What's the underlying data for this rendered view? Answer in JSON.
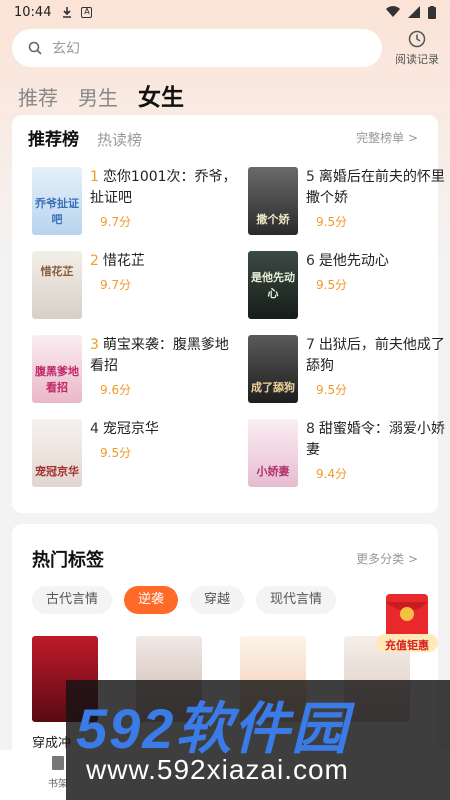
{
  "status_bar": {
    "time": "10:44"
  },
  "search": {
    "placeholder": "玄幻"
  },
  "history": {
    "label": "阅读记录"
  },
  "gender_tabs": [
    {
      "label": "推荐"
    },
    {
      "label": "男生"
    },
    {
      "label": "女生",
      "active": true
    }
  ],
  "ranking": {
    "tab_active": "推荐榜",
    "tab_other": "热读榜",
    "more": "完整榜单 >",
    "books": [
      {
        "rank": "1",
        "title": "恋你1001次：乔爷，扯证吧",
        "score": "9.7分",
        "cover_text": "乔爷扯证吧",
        "cover_color": "#cfe3f5"
      },
      {
        "rank": "2",
        "title": "惜花芷",
        "score": "9.7分",
        "cover_text": "惜花芷",
        "cover_color": "#e8e3dc"
      },
      {
        "rank": "3",
        "title": "萌宝来袭：腹黑爹地看招",
        "score": "9.6分",
        "cover_text": "腹黑爹地看招",
        "cover_color": "#f6d8e2"
      },
      {
        "rank": "4",
        "title": "宠冠京华",
        "score": "9.5分",
        "cover_text": "宠冠京华",
        "cover_color": "#efe8e4"
      },
      {
        "rank": "5",
        "title": "离婚后在前夫的怀里撒个娇",
        "score": "9.5分",
        "cover_text": "撒个娇",
        "cover_color": "#4a4a4a"
      },
      {
        "rank": "6",
        "title": "是他先动心",
        "score": "9.5分",
        "cover_text": "是他先动心",
        "cover_color": "#27332e"
      },
      {
        "rank": "7",
        "title": "出狱后，前夫他成了舔狗",
        "score": "9.5分",
        "cover_text": "成了舔狗",
        "cover_color": "#3a3a3a"
      },
      {
        "rank": "8",
        "title": "甜蜜婚令：溺爱小娇妻",
        "score": "9.4分",
        "cover_text": "小娇妻",
        "cover_color": "#f4dbe6"
      }
    ]
  },
  "hot_tags": {
    "title": "热门标签",
    "more": "更多分类 >",
    "tags": [
      {
        "label": "古代言情"
      },
      {
        "label": "逆袭",
        "active": true
      },
      {
        "label": "穿越"
      },
      {
        "label": "现代言情"
      }
    ],
    "first_book_title": "穿成冲"
  },
  "red_packet": {
    "label": "充值钜惠"
  },
  "bottom_nav": {
    "bookshelf": "书架"
  },
  "watermark": {
    "brand": "592软件园",
    "url": "www.592xiazai.com"
  },
  "colors": {
    "accent": "#ff6a28",
    "score": "#f09a2a",
    "rank_hot": "#f0a020"
  }
}
